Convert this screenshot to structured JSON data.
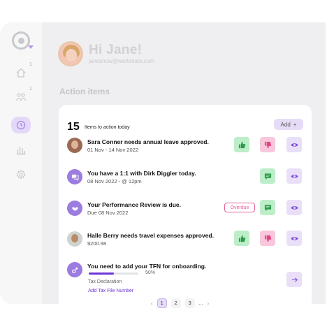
{
  "user": {
    "greeting": "Hi Jane!",
    "email": "janesnow@workmate.com"
  },
  "section_title": "Action items",
  "summary": {
    "count": "15",
    "count_label": "Items to action today",
    "add_label": "Add",
    "add_icon": "+"
  },
  "sidebar": {
    "items": [
      {
        "name": "home",
        "badge": "1"
      },
      {
        "name": "team",
        "badge": "1"
      },
      {
        "name": "clock",
        "badge": ""
      },
      {
        "name": "reports",
        "badge": ""
      },
      {
        "name": "settings",
        "badge": ""
      }
    ]
  },
  "items": [
    {
      "title": "Sara Conner needs annual leave approved.",
      "subtitle": "01 Nov - 14 Nov 2022"
    },
    {
      "title": "You have a 1:1 with Dirk Diggler today.",
      "subtitle": "08 Nov 2022 - @ 12pm"
    },
    {
      "title": "Your Performance Review is due.",
      "subtitle": "Due 08 Nov 2022",
      "badge": "Overdue"
    },
    {
      "title": "Halle Berry needs travel expenses approved.",
      "subtitle": "$200.98"
    },
    {
      "title": "You need to add your TFN for onboarding.",
      "progress": 0.5,
      "progress_label": "50%",
      "detail": "Tax Declaration",
      "link": "Add Tax File Number"
    }
  ],
  "pagination": {
    "pages": [
      "1",
      "2",
      "3"
    ],
    "ellipsis": "...",
    "prev": "‹",
    "next": "›"
  },
  "colors": {
    "accent": "#9b7ce0",
    "approve": "#bdeec9",
    "reject": "#f8c7dc",
    "view": "#eadff8",
    "overdue": "#e5609a"
  }
}
